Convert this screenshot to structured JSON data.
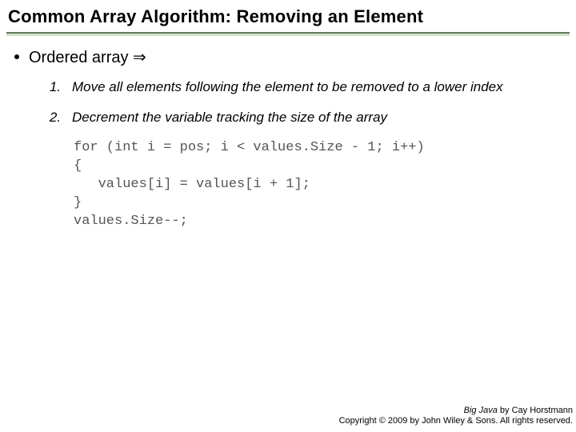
{
  "title": "Common Array Algorithm: Removing an Element",
  "bullet": "Ordered array ⇒",
  "steps": [
    {
      "num": "1.",
      "text": "Move all elements following the element to be removed to a lower index"
    },
    {
      "num": "2.",
      "text": "Decrement the variable tracking the size of the array"
    }
  ],
  "code": "for (int i = pos; i < values.Size - 1; i++)\n{\n   values[i] = values[i + 1];\n}\nvalues.Size--;",
  "footer": {
    "book": "Big Java",
    "author": " by Cay Horstmann",
    "copyright": "Copyright © 2009 by John Wiley & Sons. All rights reserved."
  }
}
